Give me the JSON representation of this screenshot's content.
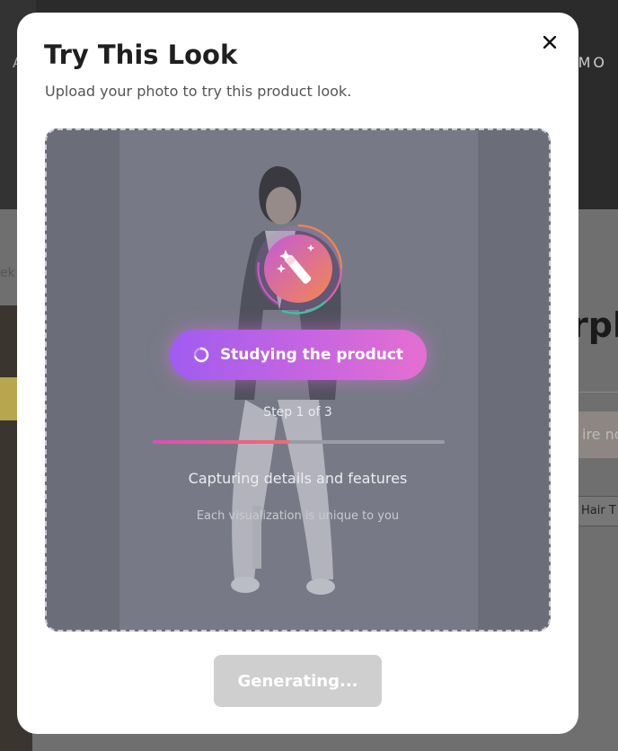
{
  "background": {
    "promo_text": "OMO",
    "left_letter": "A",
    "breadcrumb_fragment": "ek",
    "product_title_fragment": "rpl",
    "button_fragment": "ire no",
    "chip_fragment": "Hair T"
  },
  "modal": {
    "title": "Try This Look",
    "subtitle": "Upload your photo to try this product look.",
    "close_icon": "close-icon",
    "loader_icon": "magic-wand-icon",
    "status": {
      "label": "Studying the product",
      "spinner_icon": "spinner-icon"
    },
    "step_text": "Step 1 of 3",
    "progress": 0.47,
    "detail_text": "Capturing details and features",
    "note_text": "Each visualization is unique to you",
    "generate_button": "Generating..."
  },
  "colors": {
    "accent_start": "#a05cf0",
    "accent_end": "#e56fd1",
    "progress_start": "#d94fb8",
    "progress_end": "#f06d6d",
    "disabled_button": "#cfcfcf"
  }
}
